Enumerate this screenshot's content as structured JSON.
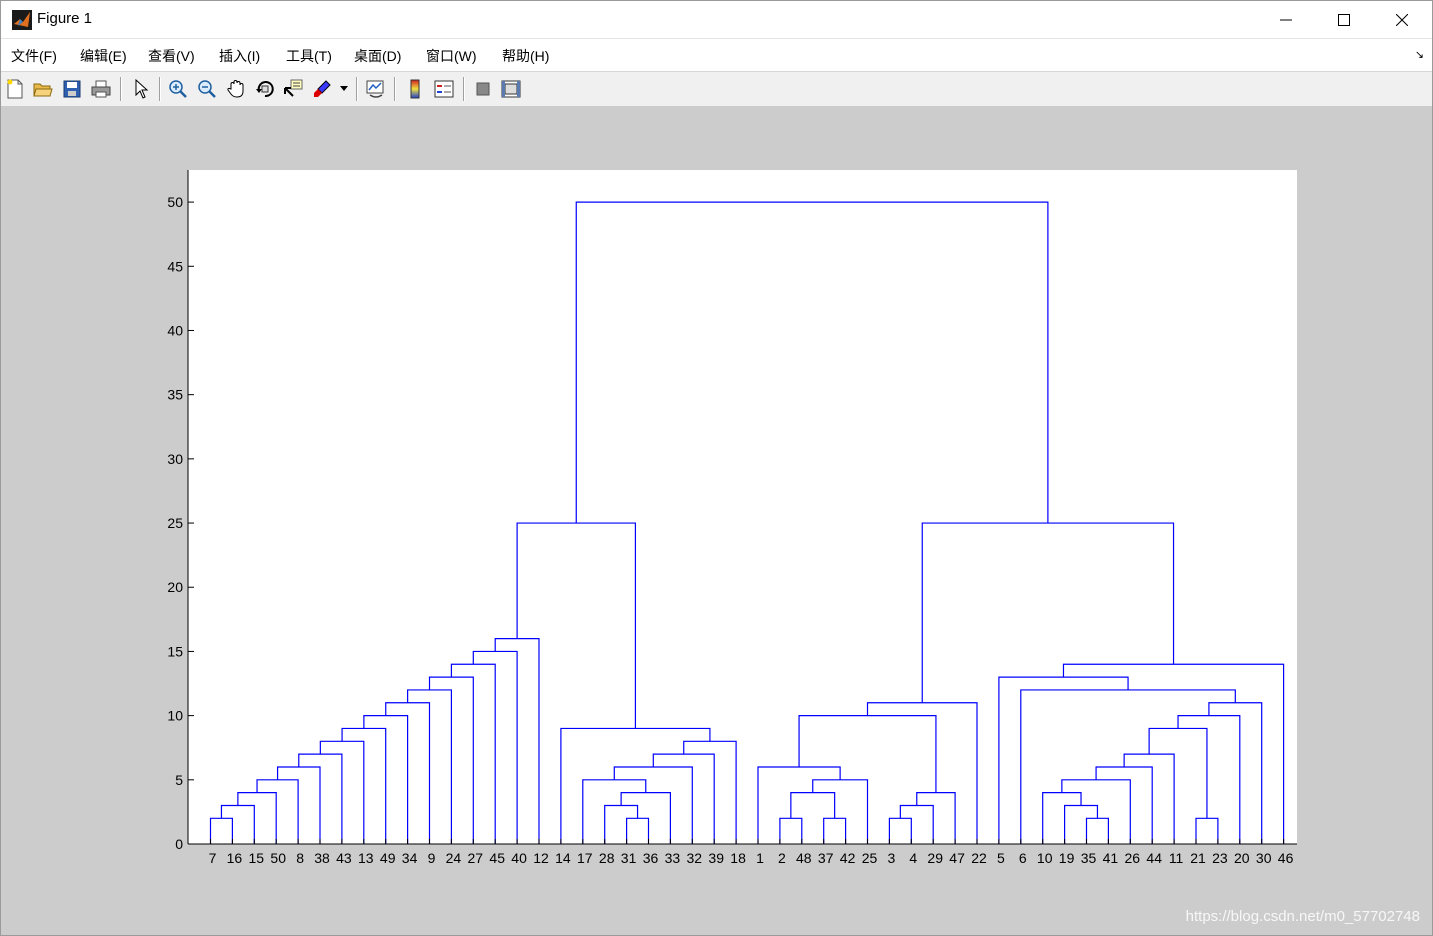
{
  "window": {
    "title": "Figure 1"
  },
  "menu": [
    "文件(F)",
    "编辑(E)",
    "查看(V)",
    "插入(I)",
    "工具(T)",
    "桌面(D)",
    "窗口(W)",
    "帮助(H)"
  ],
  "toolbar": {
    "icons": [
      "new-figure-icon",
      "open-file-icon",
      "save-icon",
      "print-icon",
      "edit-plot-arrow-icon",
      "zoom-in-icon",
      "zoom-out-icon",
      "pan-hand-icon",
      "rotate-3d-icon",
      "data-cursor-icon",
      "brush-icon",
      "link-plot-icon",
      "colorbar-icon",
      "legend-icon",
      "hide-plot-tools-icon",
      "show-plot-tools-icon"
    ]
  },
  "colors": {
    "dendrogram_line": "#0000ff",
    "figure_background": "#cccccc",
    "axes_background": "#ffffff"
  },
  "watermark": "https://blog.csdn.net/m0_57702748",
  "chart_data": {
    "type": "dendrogram",
    "title": "",
    "xlabel": "",
    "ylabel": "",
    "ylim": [
      0,
      52.5
    ],
    "yticks": [
      0,
      5,
      10,
      15,
      20,
      25,
      30,
      35,
      40,
      45,
      50
    ],
    "leaf_order": [
      "7",
      "16",
      "15",
      "50",
      "8",
      "38",
      "43",
      "13",
      "49",
      "34",
      "9",
      "24",
      "27",
      "45",
      "40",
      "12",
      "14",
      "17",
      "28",
      "31",
      "36",
      "33",
      "32",
      "39",
      "18",
      "1",
      "2",
      "48",
      "37",
      "42",
      "25",
      "3",
      "4",
      "29",
      "47",
      "22",
      "5",
      "6",
      "10",
      "19",
      "35",
      "41",
      "26",
      "44",
      "11",
      "21",
      "23",
      "20",
      "30",
      "46"
    ],
    "merges": [
      {
        "id": "A1",
        "left": "7",
        "right": "16",
        "height": 2
      },
      {
        "id": "A2",
        "left": "A1",
        "right": "15",
        "height": 3
      },
      {
        "id": "A3",
        "left": "A2",
        "right": "50",
        "height": 4
      },
      {
        "id": "A4",
        "left": "A3",
        "right": "8",
        "height": 5
      },
      {
        "id": "A5",
        "left": "A4",
        "right": "38",
        "height": 6
      },
      {
        "id": "A6",
        "left": "A5",
        "right": "43",
        "height": 7
      },
      {
        "id": "A7",
        "left": "A6",
        "right": "13",
        "height": 8
      },
      {
        "id": "A8",
        "left": "A7",
        "right": "49",
        "height": 9
      },
      {
        "id": "A9",
        "left": "A8",
        "right": "34",
        "height": 10
      },
      {
        "id": "A10",
        "left": "A9",
        "right": "9",
        "height": 11
      },
      {
        "id": "A11",
        "left": "A10",
        "right": "24",
        "height": 12
      },
      {
        "id": "A12",
        "left": "A11",
        "right": "27",
        "height": 13
      },
      {
        "id": "A13",
        "left": "A12",
        "right": "45",
        "height": 14
      },
      {
        "id": "A14",
        "left": "A13",
        "right": "40",
        "height": 15
      },
      {
        "id": "A15",
        "left": "A14",
        "right": "12",
        "height": 16
      },
      {
        "id": "B1",
        "left": "31",
        "right": "36",
        "height": 2
      },
      {
        "id": "B2",
        "left": "28",
        "right": "B1",
        "height": 3
      },
      {
        "id": "B3",
        "left": "B2",
        "right": "33",
        "height": 4
      },
      {
        "id": "B4",
        "left": "17",
        "right": "B3",
        "height": 5
      },
      {
        "id": "B5",
        "left": "B4",
        "right": "32",
        "height": 6
      },
      {
        "id": "B6",
        "left": "B5",
        "right": "39",
        "height": 7
      },
      {
        "id": "B7",
        "left": "B6",
        "right": "18",
        "height": 8
      },
      {
        "id": "B8",
        "left": "14",
        "right": "B7",
        "height": 9
      },
      {
        "id": "C1",
        "left": "A15",
        "right": "B8",
        "height": 25
      },
      {
        "id": "D1",
        "left": "2",
        "right": "48",
        "height": 2
      },
      {
        "id": "D2",
        "left": "37",
        "right": "42",
        "height": 2
      },
      {
        "id": "D3",
        "left": "D1",
        "right": "D2",
        "height": 4
      },
      {
        "id": "D4",
        "left": "D3",
        "right": "25",
        "height": 5
      },
      {
        "id": "D5",
        "left": "1",
        "right": "D4",
        "height": 6
      },
      {
        "id": "D6",
        "left": "3",
        "right": "4",
        "height": 2
      },
      {
        "id": "D7",
        "left": "D6",
        "right": "29",
        "height": 3
      },
      {
        "id": "D8",
        "left": "D7",
        "right": "47",
        "height": 4
      },
      {
        "id": "D9",
        "left": "D5",
        "right": "D8",
        "height": 10
      },
      {
        "id": "D10",
        "left": "D9",
        "right": "22",
        "height": 11
      },
      {
        "id": "E1",
        "left": "35",
        "right": "41",
        "height": 2
      },
      {
        "id": "E2",
        "left": "19",
        "right": "E1",
        "height": 3
      },
      {
        "id": "E3",
        "left": "10",
        "right": "E2",
        "height": 4
      },
      {
        "id": "E4",
        "left": "E3",
        "right": "26",
        "height": 5
      },
      {
        "id": "E5",
        "left": "E4",
        "right": "44",
        "height": 6
      },
      {
        "id": "E6",
        "left": "E5",
        "right": "11",
        "height": 7
      },
      {
        "id": "E7",
        "left": "21",
        "right": "23",
        "height": 2
      },
      {
        "id": "E8",
        "left": "E6",
        "right": "E7",
        "height": 9
      },
      {
        "id": "E9",
        "left": "E8",
        "right": "20",
        "height": 10
      },
      {
        "id": "E10",
        "left": "E9",
        "right": "30",
        "height": 11
      },
      {
        "id": "E11",
        "left": "6",
        "right": "E10",
        "height": 12
      },
      {
        "id": "E12",
        "left": "5",
        "right": "E11",
        "height": 13
      },
      {
        "id": "E13",
        "left": "E12",
        "right": "46",
        "height": 14
      },
      {
        "id": "F1",
        "left": "D10",
        "right": "E13",
        "height": 25
      },
      {
        "id": "ROOT",
        "left": "C1",
        "right": "F1",
        "height": 50
      }
    ]
  }
}
